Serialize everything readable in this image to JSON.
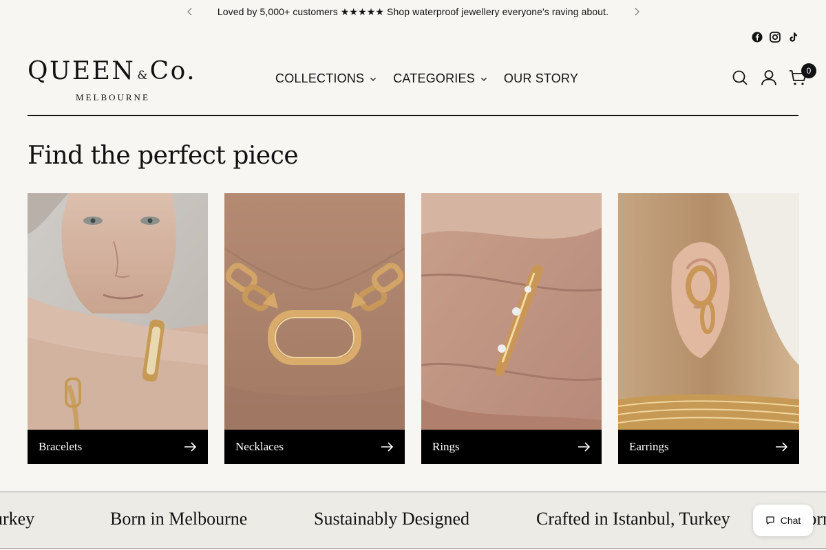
{
  "announcement": {
    "text": "Loved by 5,000+ customers ★★★★★ Shop waterproof jewellery everyone's raving about.",
    "prev_icon": "chevron-left-icon",
    "next_icon": "chevron-right-icon"
  },
  "socials": [
    "facebook-icon",
    "instagram-icon",
    "tiktok-icon"
  ],
  "logo": {
    "main_left": "QUEEN",
    "amp": "&",
    "main_right": "Co.",
    "sub": "MELBOURNE"
  },
  "nav": {
    "items": [
      {
        "label": "COLLECTIONS",
        "has_dropdown": true
      },
      {
        "label": "CATEGORIES",
        "has_dropdown": true
      },
      {
        "label": "OUR STORY",
        "has_dropdown": false
      }
    ]
  },
  "header_icons": {
    "search": "search-icon",
    "account": "account-icon",
    "cart": "cart-icon",
    "cart_count": "0"
  },
  "section": {
    "title": "Find the perfect piece"
  },
  "categories": [
    {
      "label": "Bracelets"
    },
    {
      "label": "Necklaces"
    },
    {
      "label": "Rings"
    },
    {
      "label": "Earrings"
    }
  ],
  "marquee": {
    "items": [
      "Turkey",
      "Born in Melbourne",
      "Sustainably Designed",
      "Crafted in Istanbul, Turkey",
      "Born"
    ]
  },
  "chat": {
    "label": "Chat"
  },
  "colors": {
    "background": "#f7f6f2",
    "bar": "#000000",
    "marquee_bg": "#ecebe6",
    "gold": "#c9a063"
  }
}
